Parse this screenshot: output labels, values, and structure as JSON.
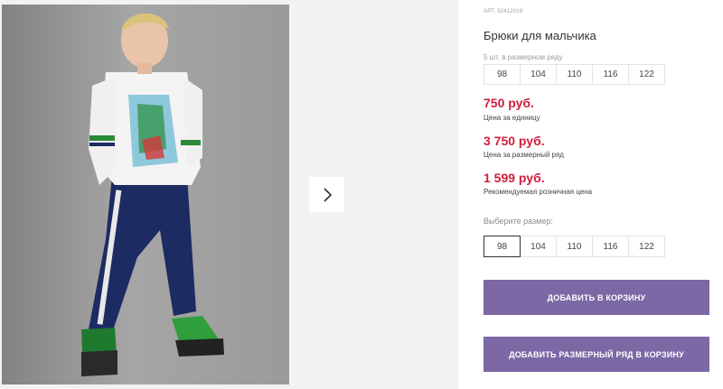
{
  "product": {
    "article": "АРТ. 32412019",
    "title": "Брюки для мальчика",
    "size_row_note": "5 шт. в размерном ряду",
    "size_row": [
      "98",
      "104",
      "110",
      "116",
      "122"
    ],
    "prices": [
      {
        "value": "750 руб.",
        "label": "Цена за единицу"
      },
      {
        "value": "3 750 руб.",
        "label": "Цена за размерный ряд"
      },
      {
        "value": "1 599 руб.",
        "label": "Рекомендуемая розничная цена"
      }
    ],
    "choose_size_label": "Выберите размер:",
    "size_options": [
      "98",
      "104",
      "110",
      "116",
      "122"
    ],
    "selected_size": "98",
    "add_to_cart_label": "ДОБАВИТЬ В КОРЗИНУ",
    "add_size_row_label": "ДОБАВИТЬ РАЗМЕРНЫЙ РЯД В КОРЗИНУ"
  },
  "gallery": {
    "image": "product-photo-boy",
    "next_icon": "chevron-right-icon"
  },
  "colors": {
    "price": "#d21e3c",
    "button": "#7b68a4"
  }
}
